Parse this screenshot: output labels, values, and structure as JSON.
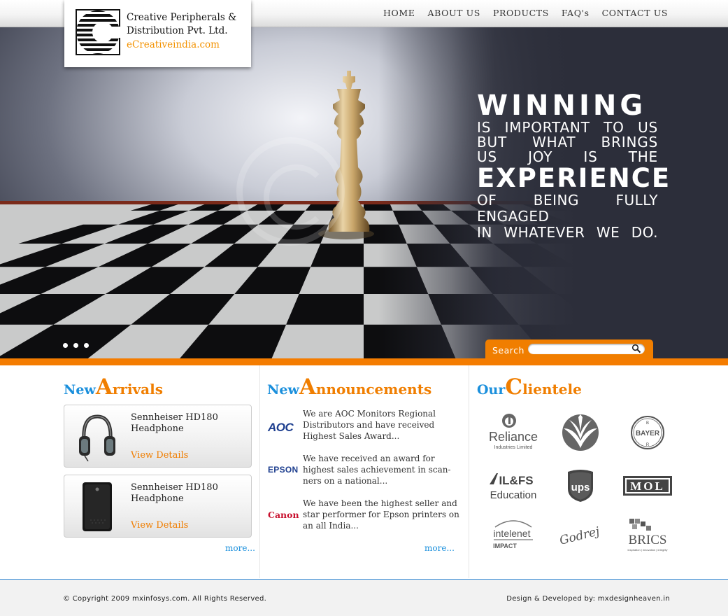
{
  "nav": {
    "items": [
      "HOME",
      "ABOUT US",
      "PRODUCTS",
      "FAQ's",
      "CONTACT US"
    ]
  },
  "logo": {
    "company_line1": "Creative Peripherals &",
    "company_line2": "Distribution Pvt. Ltd.",
    "website": "eCreativeindia.com"
  },
  "hero": {
    "slogan": {
      "line1": "WINNING",
      "line2": "IS IMPORTANT TO US",
      "line3": "BUT WHAT BRINGS",
      "line4": "US JOY IS THE",
      "line5": "EXPERIENCE",
      "line6": "OF BEING FULLY ENGAGED",
      "line7": "IN WHATEVER WE DO."
    },
    "slide_count": 3
  },
  "search": {
    "label": "Search",
    "value": "",
    "placeholder": ""
  },
  "new_arrivals": {
    "heading_word1": "New",
    "heading_cap": "A",
    "heading_rest": "rrivals",
    "products": [
      {
        "name": "Sennheiser HD180 Headphone",
        "link": "View Details",
        "thumb": "headphone-icon"
      },
      {
        "name": "Sennheiser HD180 Headphone",
        "link": "View Details",
        "thumb": "hard-drive-icon"
      }
    ],
    "more": "more..."
  },
  "announcements": {
    "heading_word1": "New",
    "heading_cap": "A",
    "heading_rest": "nnouncements",
    "items": [
      {
        "brand": "AOC",
        "text": "We are AOC Monitors Regional Distributors and have received Highest Sales Award..."
      },
      {
        "brand": "EPSON",
        "text": "We have received an award for highest sales achievement in scan-ners on a national..."
      },
      {
        "brand": "Canon",
        "text": "We have been the highest seller and star performer for Epson printers on an all India..."
      }
    ],
    "more": "more..."
  },
  "clientele": {
    "heading_word1": "Our",
    "heading_cap": "C",
    "heading_rest": "lientele",
    "clients": [
      {
        "name": "Reliance",
        "sub": "Industries Limited",
        "icon": "reliance-logo"
      },
      {
        "name": "",
        "sub": "",
        "icon": "indian-oil-logo"
      },
      {
        "name": "BAYER",
        "sub": "",
        "icon": "bayer-logo"
      },
      {
        "name": "IL&FS",
        "sub": "Education",
        "icon": "ilfs-logo"
      },
      {
        "name": "ups",
        "sub": "",
        "icon": "ups-logo"
      },
      {
        "name": "MOL",
        "sub": "",
        "icon": "mol-logo"
      },
      {
        "name": "intelenet",
        "sub": "IMPACT",
        "icon": "intelenet-logo"
      },
      {
        "name": "Godrej",
        "sub": "",
        "icon": "godrej-logo"
      },
      {
        "name": "BRICS",
        "sub": "inspiration | innovation | integrity",
        "icon": "brics-logo"
      }
    ]
  },
  "footer": {
    "copyright": "© Copyright 2009 mxinfosys.com. All Rights Reserved.",
    "credit": "Design & Developed by: mxdesignheaven.in"
  },
  "colors": {
    "accent": "#f47c00",
    "link_blue": "#1a8fdc",
    "hero_dark": "#2c2e3a"
  }
}
